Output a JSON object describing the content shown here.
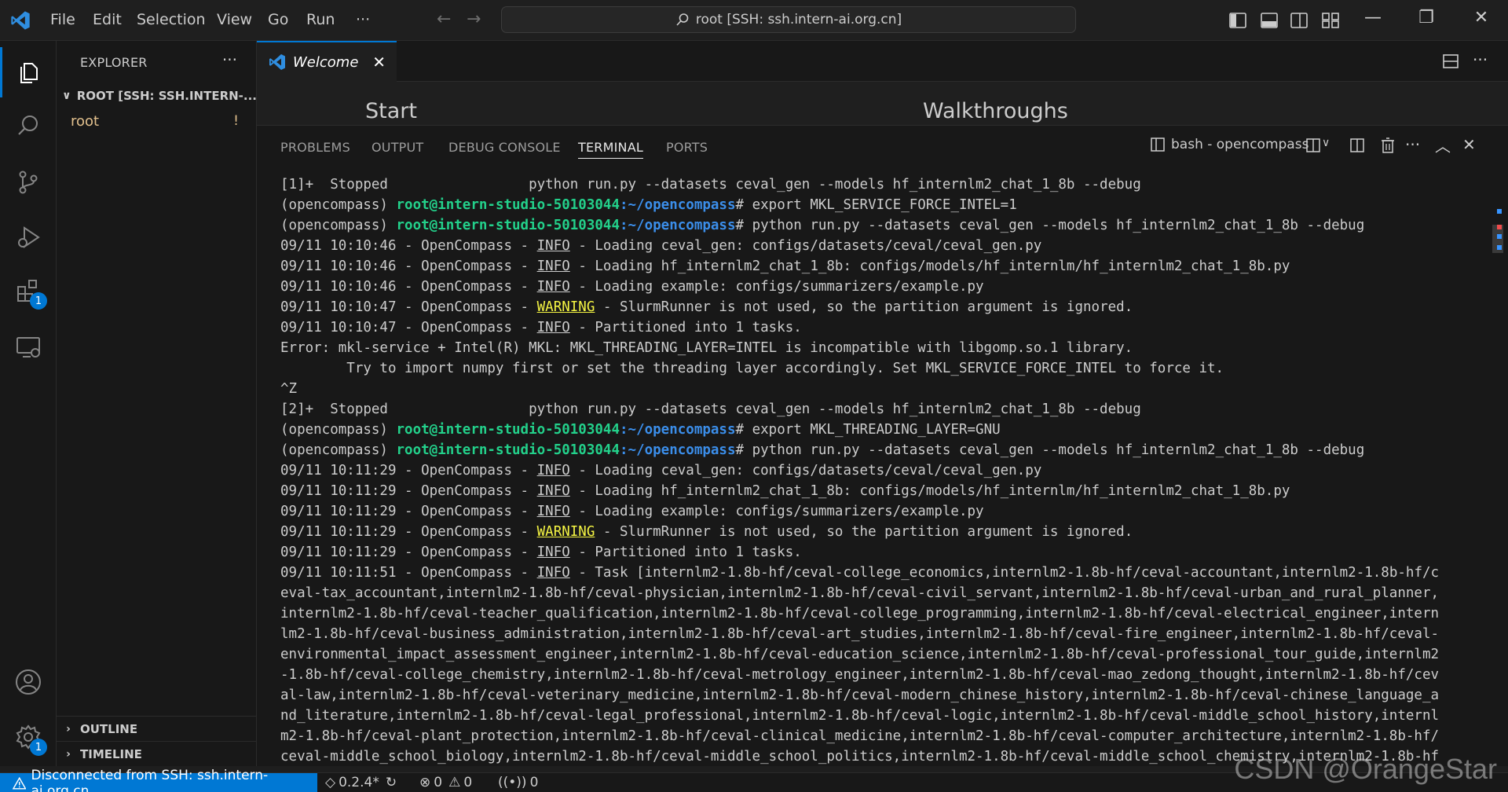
{
  "titlebar": {
    "menu": [
      "File",
      "Edit",
      "Selection",
      "View",
      "Go",
      "Run"
    ],
    "more": "···",
    "command_center": "root [SSH: ssh.intern-ai.org.cn]",
    "icons": [
      "toggle-sidebar-icon",
      "toggle-panel-icon",
      "toggle-secondary-sidebar-icon",
      "customize-layout-icon"
    ]
  },
  "activitybar": {
    "items": [
      "explorer-icon",
      "search-icon",
      "source-control-icon",
      "run-debug-icon",
      "extensions-icon",
      "remote-explorer-icon"
    ],
    "extensions_badge": "1",
    "settings_badge": "1"
  },
  "sidebar": {
    "title": "EXPLORER",
    "more": "···",
    "root_label": "ROOT [SSH: SSH.INTERN-...",
    "folder": "root",
    "folder_status": "!",
    "outline": "OUTLINE",
    "timeline": "TIMELINE"
  },
  "editor": {
    "tab_label": "Welcome",
    "tab_close": "✕",
    "headings": {
      "start": "Start",
      "walkthroughs": "Walkthroughs"
    }
  },
  "panel": {
    "tabs": [
      "PROBLEMS",
      "OUTPUT",
      "DEBUG CONSOLE",
      "TERMINAL",
      "PORTS"
    ],
    "active_tab": "TERMINAL",
    "terminal_name": "bash - opencompass"
  },
  "terminal": {
    "lines": [
      {
        "mark": "",
        "text": "[1]+  Stopped                 python run.py --datasets ceval_gen --models hf_internlm2_chat_1_8b --debug"
      },
      {
        "mark": "ok",
        "env": "(opencompass) ",
        "user": "root@intern-studio-50103044",
        "path": ":~/opencompass",
        "cmd": "# export MKL_SERVICE_FORCE_INTEL=1"
      },
      {
        "mark": "err",
        "env": "(opencompass) ",
        "user": "root@intern-studio-50103044",
        "path": ":~/opencompass",
        "cmd": "# python run.py --datasets ceval_gen --models hf_internlm2_chat_1_8b --debug"
      },
      {
        "pre": "09/11 10:10:46 - OpenCompass - ",
        "level": "INFO",
        "msg": " - Loading ceval_gen: configs/datasets/ceval/ceval_gen.py"
      },
      {
        "pre": "09/11 10:10:46 - OpenCompass - ",
        "level": "INFO",
        "msg": " - Loading hf_internlm2_chat_1_8b: configs/models/hf_internlm/hf_internlm2_chat_1_8b.py"
      },
      {
        "pre": "09/11 10:10:46 - OpenCompass - ",
        "level": "INFO",
        "msg": " - Loading example: configs/summarizers/example.py"
      },
      {
        "pre": "09/11 10:10:47 - OpenCompass - ",
        "level": "WARNING",
        "msg": " - SlurmRunner is not used, so the partition argument is ignored."
      },
      {
        "pre": "09/11 10:10:47 - OpenCompass - ",
        "level": "INFO",
        "msg": " - Partitioned into 1 tasks."
      },
      {
        "text": "Error: mkl-service + Intel(R) MKL: MKL_THREADING_LAYER=INTEL is incompatible with libgomp.so.1 library."
      },
      {
        "text": "        Try to import numpy first or set the threading layer accordingly. Set MKL_SERVICE_FORCE_INTEL to force it."
      },
      {
        "text": "^Z"
      },
      {
        "text": "[2]+  Stopped                 python run.py --datasets ceval_gen --models hf_internlm2_chat_1_8b --debug"
      },
      {
        "mark": "ok",
        "env": "(opencompass) ",
        "user": "root@intern-studio-50103044",
        "path": ":~/opencompass",
        "cmd": "# export MKL_THREADING_LAYER=GNU"
      },
      {
        "mark": "ok",
        "env": "(opencompass) ",
        "user": "root@intern-studio-50103044",
        "path": ":~/opencompass",
        "cmd": "# python run.py --datasets ceval_gen --models hf_internlm2_chat_1_8b --debug"
      },
      {
        "pre": "09/11 10:11:29 - OpenCompass - ",
        "level": "INFO",
        "msg": " - Loading ceval_gen: configs/datasets/ceval/ceval_gen.py"
      },
      {
        "pre": "09/11 10:11:29 - OpenCompass - ",
        "level": "INFO",
        "msg": " - Loading hf_internlm2_chat_1_8b: configs/models/hf_internlm/hf_internlm2_chat_1_8b.py"
      },
      {
        "pre": "09/11 10:11:29 - OpenCompass - ",
        "level": "INFO",
        "msg": " - Loading example: configs/summarizers/example.py"
      },
      {
        "pre": "09/11 10:11:29 - OpenCompass - ",
        "level": "WARNING",
        "msg": " - SlurmRunner is not used, so the partition argument is ignored."
      },
      {
        "pre": "09/11 10:11:29 - OpenCompass - ",
        "level": "INFO",
        "msg": " - Partitioned into 1 tasks."
      },
      {
        "pre": "09/11 10:11:51 - OpenCompass - ",
        "level": "INFO",
        "msg": " - Task [internlm2-1.8b-hf/ceval-college_economics,internlm2-1.8b-hf/ceval-accountant,internlm2-1.8b-hf/c"
      },
      {
        "text": "eval-tax_accountant,internlm2-1.8b-hf/ceval-physician,internlm2-1.8b-hf/ceval-civil_servant,internlm2-1.8b-hf/ceval-urban_and_rural_planner,"
      },
      {
        "text": "internlm2-1.8b-hf/ceval-teacher_qualification,internlm2-1.8b-hf/ceval-college_programming,internlm2-1.8b-hf/ceval-electrical_engineer,intern"
      },
      {
        "text": "lm2-1.8b-hf/ceval-business_administration,internlm2-1.8b-hf/ceval-art_studies,internlm2-1.8b-hf/ceval-fire_engineer,internlm2-1.8b-hf/ceval-"
      },
      {
        "text": "environmental_impact_assessment_engineer,internlm2-1.8b-hf/ceval-education_science,internlm2-1.8b-hf/ceval-professional_tour_guide,internlm2"
      },
      {
        "text": "-1.8b-hf/ceval-college_chemistry,internlm2-1.8b-hf/ceval-metrology_engineer,internlm2-1.8b-hf/ceval-mao_zedong_thought,internlm2-1.8b-hf/cev"
      },
      {
        "text": "al-law,internlm2-1.8b-hf/ceval-veterinary_medicine,internlm2-1.8b-hf/ceval-modern_chinese_history,internlm2-1.8b-hf/ceval-chinese_language_a"
      },
      {
        "text": "nd_literature,internlm2-1.8b-hf/ceval-legal_professional,internlm2-1.8b-hf/ceval-logic,internlm2-1.8b-hf/ceval-middle_school_history,internl"
      },
      {
        "text": "m2-1.8b-hf/ceval-plant_protection,internlm2-1.8b-hf/ceval-clinical_medicine,internlm2-1.8b-hf/ceval-computer_architecture,internlm2-1.8b-hf/"
      },
      {
        "text": "ceval-middle_school_biology,internlm2-1.8b-hf/ceval-middle_school_politics,internlm2-1.8b-hf/ceval-middle_school_chemistry,internlm2-1.8b-hf"
      }
    ]
  },
  "statusbar": {
    "remote": "Disconnected from SSH: ssh.intern-ai.org.cn",
    "version": "0.2.4*",
    "errors": "0",
    "warnings": "0",
    "ports": "0"
  },
  "watermark": "CSDN @OrangeStar"
}
